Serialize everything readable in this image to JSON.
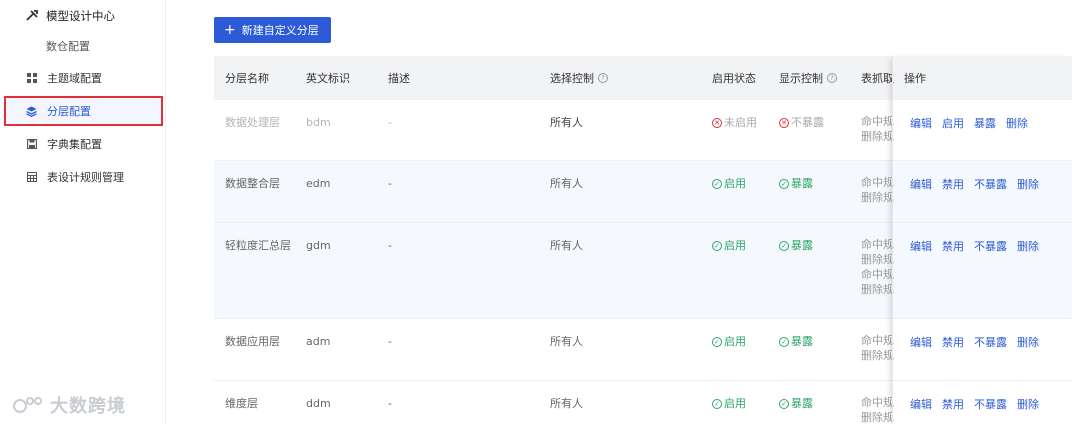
{
  "sidebar": {
    "title": "模型设计中心",
    "subtitle": "数仓配置",
    "items": [
      {
        "label": "主题域配置",
        "icon": "grid-icon"
      },
      {
        "label": "分层配置",
        "icon": "layers-icon"
      },
      {
        "label": "字典集配置",
        "icon": "save-icon"
      },
      {
        "label": "表设计规则管理",
        "icon": "table-icon"
      }
    ],
    "watermark": "大数跨境"
  },
  "toolbar": {
    "new_button": "新建自定义分层"
  },
  "table": {
    "headers": {
      "name": "分层名称",
      "code": "英文标识",
      "desc": "描述",
      "select_ctrl": "选择控制",
      "enable_status": "启用状态",
      "display_ctrl": "显示控制",
      "table_fetch": "表抓取",
      "ops": "操作"
    },
    "help_glyph": "?",
    "rows": [
      {
        "name": "数据处理层",
        "code": "bdm",
        "desc": "-",
        "select": "所有人",
        "enable": "未启用",
        "display": "不暴露",
        "rules": [
          "命中规",
          "删除规"
        ],
        "ops": [
          "编辑",
          "启用",
          "暴露",
          "删除"
        ],
        "enabled": false
      },
      {
        "name": "数据整合层",
        "code": "edm",
        "desc": "-",
        "select": "所有人",
        "enable": "启用",
        "display": "暴露",
        "rules": [
          "命中规",
          "删除规"
        ],
        "ops": [
          "编辑",
          "禁用",
          "不暴露",
          "删除"
        ],
        "enabled": true
      },
      {
        "name": "轻粒度汇总层",
        "code": "gdm",
        "desc": "-",
        "select": "所有人",
        "enable": "启用",
        "display": "暴露",
        "rules": [
          "命中规",
          "删除规",
          "命中规",
          "删除规"
        ],
        "ops": [
          "编辑",
          "禁用",
          "不暴露",
          "删除"
        ],
        "enabled": true
      },
      {
        "name": "数据应用层",
        "code": "adm",
        "desc": "-",
        "select": "所有人",
        "enable": "启用",
        "display": "暴露",
        "rules": [
          "命中规",
          "删除规"
        ],
        "ops": [
          "编辑",
          "禁用",
          "不暴露",
          "删除"
        ],
        "enabled": true
      },
      {
        "name": "维度层",
        "code": "ddm",
        "desc": "-",
        "select": "所有人",
        "enable": "启用",
        "display": "暴露",
        "rules": [
          "命中规",
          "删除规"
        ],
        "ops": [
          "编辑",
          "禁用",
          "不暴露",
          "删除"
        ],
        "enabled": true
      }
    ]
  },
  "colors": {
    "primary": "#2d5bd8",
    "danger": "#e0313a",
    "success": "#30a46c",
    "highlight_border": "#e0313a"
  }
}
